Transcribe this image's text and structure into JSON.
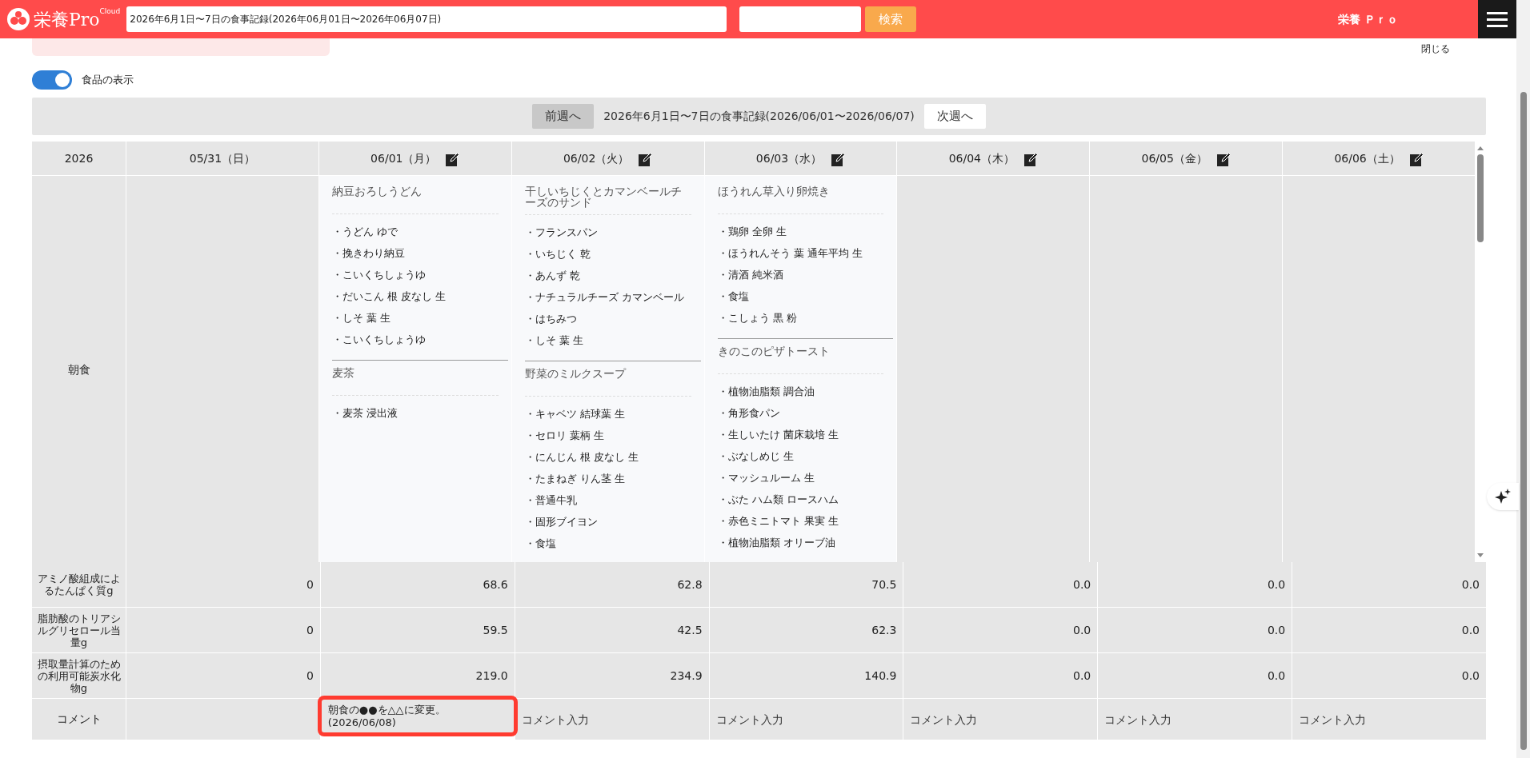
{
  "header": {
    "logo": "栄養Pro",
    "logo_sup": "Cloud",
    "search_value": "2026年6月1日〜7日の食事記録(2026年06月01日〜2026年06月07日)",
    "search_button": "検索",
    "user": "栄養 Ｐｒｏ"
  },
  "close_link": "閉じる",
  "toggle": {
    "label": "食品の表示",
    "on": true
  },
  "week_nav": {
    "prev": "前週へ",
    "title": "2026年6月1日〜7日の食事記録(2026/06/01〜2026/06/07)",
    "next": "次週へ"
  },
  "table": {
    "year": "2026",
    "meal_label": "朝食",
    "days": [
      {
        "date": "05/31（日）",
        "editable": false
      },
      {
        "date": "06/01（月）",
        "editable": true,
        "dishes": [
          {
            "name": "納豆おろしうどん",
            "foods": [
              "・うどん ゆで",
              "・挽きわり納豆",
              "・こいくちしょうゆ",
              "・だいこん 根 皮なし 生",
              "・しそ 葉 生",
              "・こいくちしょうゆ"
            ]
          },
          {
            "name": "麦茶",
            "foods": [
              "・麦茶 浸出液"
            ]
          }
        ]
      },
      {
        "date": "06/02（火）",
        "editable": true,
        "dishes": [
          {
            "name": "干しいちじくとカマンベールチーズのサンド",
            "foods": [
              "・フランスパン",
              "・いちじく 乾",
              "・あんず 乾",
              "・ナチュラルチーズ カマンベール",
              "・はちみつ",
              "・しそ 葉 生"
            ]
          },
          {
            "name": "野菜のミルクスープ",
            "foods": [
              "・キャベツ 結球葉 生",
              "・セロリ 葉柄 生",
              "・にんじん 根 皮なし 生",
              "・たまねぎ りん茎 生",
              "・普通牛乳",
              "・固形ブイヨン",
              "・食塩"
            ]
          }
        ]
      },
      {
        "date": "06/03（水）",
        "editable": true,
        "dishes": [
          {
            "name": "ほうれん草入り卵焼き",
            "foods": [
              "・鶏卵 全卵 生",
              "・ほうれんそう 葉 通年平均 生",
              "・清酒 純米酒",
              "・食塩",
              "・こしょう 黒 粉"
            ]
          },
          {
            "name": "きのこのピザトースト",
            "foods": [
              "・植物油脂類 調合油",
              "・角形食パン",
              "・生しいたけ 菌床栽培 生",
              "・ぶなしめじ 生",
              "・マッシュルーム 生",
              "・ぶた ハム類 ロースハム",
              "・赤色ミニトマト 果実 生",
              "・植物油脂類 オリーブ油"
            ]
          }
        ]
      },
      {
        "date": "06/04（木）",
        "editable": true
      },
      {
        "date": "06/05（金）",
        "editable": true
      },
      {
        "date": "06/06（土）",
        "editable": true
      }
    ],
    "nutrients": [
      {
        "label": "アミノ酸組成によるたんぱく質g",
        "values": [
          "0",
          "68.6",
          "62.8",
          "70.5",
          "0.0",
          "0.0",
          "0.0"
        ]
      },
      {
        "label": "脂肪酸のトリアシルグリセロール当量g",
        "values": [
          "0",
          "59.5",
          "42.5",
          "62.3",
          "0.0",
          "0.0",
          "0.0"
        ]
      },
      {
        "label": "摂取量計算のための利用可能炭水化物g",
        "values": [
          "0",
          "219.0",
          "234.9",
          "140.9",
          "0.0",
          "0.0",
          "0.0"
        ]
      }
    ],
    "comment": {
      "label": "コメント",
      "cells": [
        {
          "kind": "empty"
        },
        {
          "kind": "text",
          "value": "朝食の●●を△△に変更。\n(2026/06/08)",
          "highlighted": true
        },
        {
          "kind": "input",
          "placeholder": "コメント入力",
          "highlighted": false
        },
        {
          "kind": "input",
          "placeholder": "コメント入力",
          "highlighted": false
        },
        {
          "kind": "input",
          "placeholder": "コメント入力",
          "highlighted": false
        },
        {
          "kind": "input",
          "placeholder": "コメント入力",
          "highlighted": false
        },
        {
          "kind": "input",
          "placeholder": "コメント入力",
          "highlighted": false
        }
      ]
    }
  }
}
